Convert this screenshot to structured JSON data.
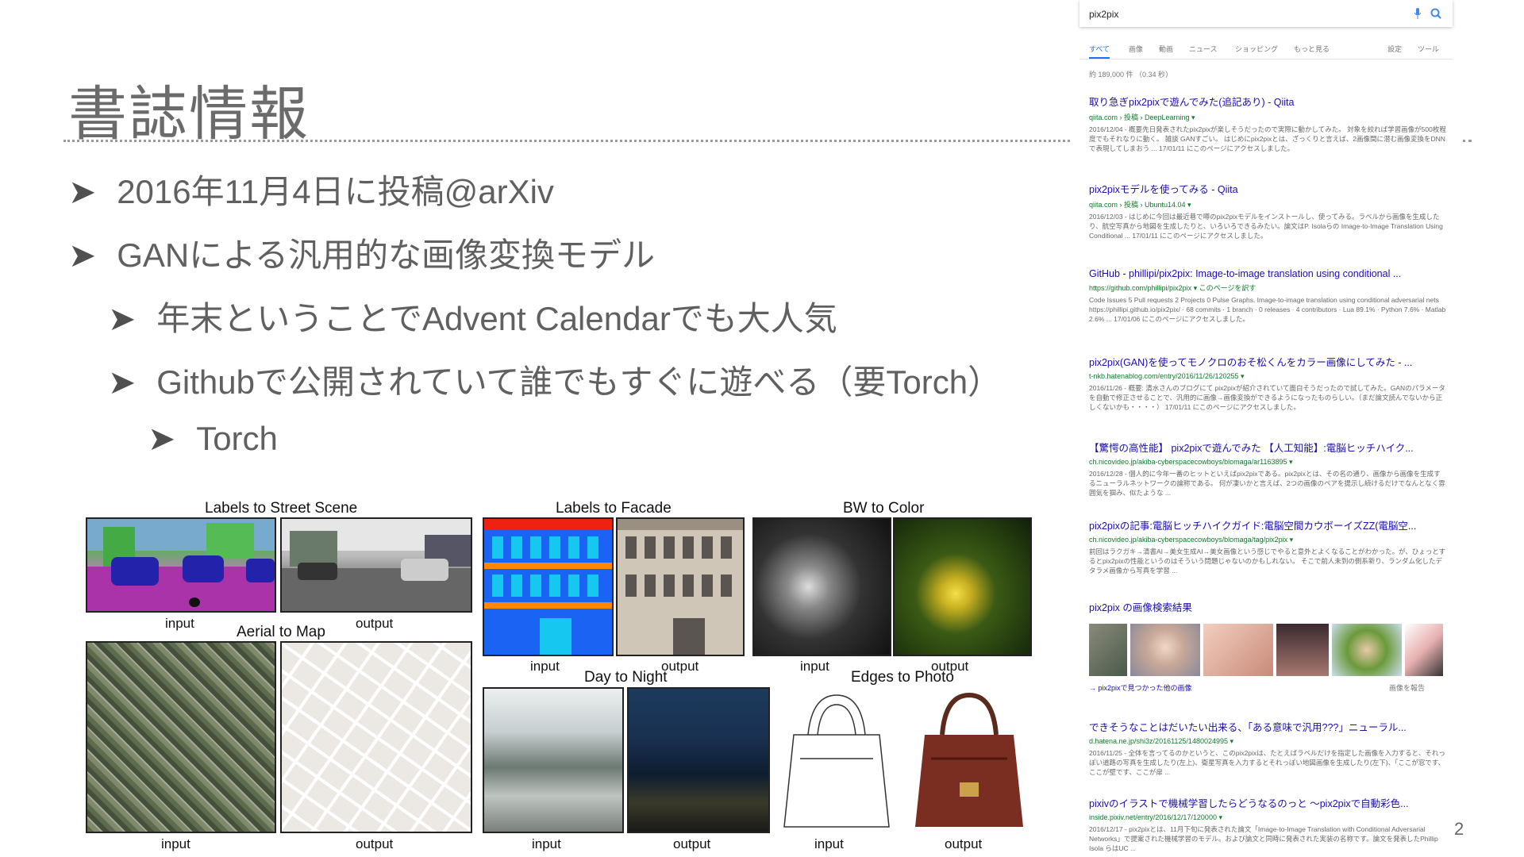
{
  "slide": {
    "title": "書誌情報",
    "page_number": "2",
    "bullets": [
      {
        "text": "2016年11月4日に投稿@arXiv",
        "level": 1
      },
      {
        "text": "GANによる汎用的な画像変換モデル",
        "level": 1
      },
      {
        "text": "年末ということでAdvent Calendarでも大人気",
        "level": 2
      },
      {
        "text": "Githubで公開されていて誰でもすぐに遊べる（要Torch）",
        "level": 2
      },
      {
        "text": "Torch",
        "level": 3
      }
    ],
    "bullet_marker": "➤"
  },
  "figure": {
    "captions": {
      "labels_street": "Labels to Street Scene",
      "labels_facade": "Labels to Facade",
      "bw_color": "BW to Color",
      "aerial_map": "Aerial to Map",
      "day_night": "Day to Night",
      "edges_photo": "Edges to Photo"
    },
    "input_label": "input",
    "output_label": "output"
  },
  "serp": {
    "query": "pix2pix",
    "tabs": [
      "すべて",
      "画像",
      "動画",
      "ニュース",
      "ショッピング",
      "もっと見る",
      "設定",
      "ツール"
    ],
    "result_count": "約 189,000 件 （0.34 秒）",
    "results": [
      {
        "title": "取り急ぎpix2pixで遊んでみた(追記あり) - Qiita",
        "url": "qiita.com › 投稿 › DeepLearning ▾",
        "snippet": "2016/12/04 - 概要先日発表されたpix2pixが楽しそうだったので実際に動かしてみた。 対象を絞れば学習画像が500枚程度でもそれなりに動く。 雑談 GANすごい。 はじめにpix2pixとは、ざっくりと言えば、2画像間に潜む画像変換をDNNで表現してしまおう ...\n17/01/11 にこのページにアクセスしました。"
      },
      {
        "title": "pix2pixモデルを使ってみる - Qiita",
        "url": "qiita.com › 投稿 › Ubuntu14.04 ▾",
        "snippet": "2016/12/03 - はじめに今回は最近巷で噂のpix2pixモデルをインストールし、使ってみる。ラベルから画像を生成したり、航空写真から地図を生成したりと、いろいろできるみたい。論文はP. Isolaらの Image-to-Image Translation Using Conditional ...\n17/01/11 にこのページにアクセスしました。"
      },
      {
        "title": "GitHub - phillipi/pix2pix: Image-to-image translation using conditional ...",
        "url": "https://github.com/phillipi/pix2pix ▾ このページを訳す",
        "snippet": "Code Issues 5 Pull requests 2 Projects 0 Pulse Graphs. Image-to-image translation using conditional adversarial nets https://phillipi.github.io/pix2pix/ · 68 commits · 1 branch · 0 releases · 4 contributors · Lua 89.1% · Python 7.6% · Matlab 2.6% ...\n17/01/06 にこのページにアクセスしました。"
      },
      {
        "title": "pix2pix(GAN)を使ってモノクロのおそ松くんをカラー画像にしてみた - ...",
        "url": "t-nkb.hatenablog.com/entry/2016/11/26/120255 ▾",
        "snippet": "2016/11/26 - 概要: 清水さんのブログにて pix2pixが紹介されていて面白そうだったので試してみた。GANのパラメータを自動で修正させることで、汎用的に画像→画像変換ができるようになったものらしい。（まだ論文読んでないから正しくないかも・・・・）\n17/01/11 にこのページにアクセスしました。"
      },
      {
        "title": "【驚愕の高性能】 pix2pixで遊んでみた 【人工知能】:電脳ヒッチハイク...",
        "url": "ch.nicovideo.jp/akiba-cyberspacecowboys/blomaga/ar1163895 ▾",
        "snippet": "2016/12/28 - 個人的に今年一番のヒットといえばpix2pixである。pix2pixとは、その名の通り、画像から画像を生成するニューラルネットワークの論称である。 何が凄いかと言えば、2つの画像のペアを提示し続けるだけでなんとなく雰囲気を掴み、似たような ..."
      },
      {
        "title": "pix2pixの記事:電脳ヒッチハイクガイド:電脳空間カウボーイズZZ(電脳空...",
        "url": "ch.nicovideo.jp/akiba-cyberspacecowboys/blomaga/tag/pix2pix ▾",
        "snippet": "前回はラクガキ→清書AI→美女生成AI→美女画像という感じでやると意外とよくなることがわかった。が、ひょっとするとpix2pixの性能というのはそういう問題じゃないのかもしれない。 そこで前人未到の側系新り、ランダム化したデタラメ画像から写真を学習 ..."
      }
    ],
    "image_section_title": "pix2pix の画像検索結果",
    "more_images": "pix2pixで見つかった他の画像",
    "report_images": "画像を報告",
    "results2": [
      {
        "title": "できそうなことはだいたい出来る、「ある意味で汎用???」ニューラル...",
        "url": "d.hatena.ne.jp/shi3z/20161125/1480024995 ▾",
        "snippet": "2016/11/25 - 全体を言ってるのかというと、このpix2pixは、たとえばラベルだけを指定した画像を入力すると、それっぽい道路の写真を生成したり(左上)、衛星写真を入力するとそれっぽい地図画像を生成したり(左下)、「ここが窓です、ここが壁です、ここが扉 ..."
      },
      {
        "title": "pixivのイラストで機械学習したらどうなるのっと ～pix2pixで自動彩色...",
        "url": "inside.pixiv.net/entry/2016/12/17/120000 ▾",
        "snippet": "2016/12/17 - pix2pixとは、11月下旬に発表された論文「Image-to-Image Translation with Conditional Adversarial Networks」で提案された機械学習のモデル。および論文と同時に発表された実装の名称です。論文を発表したPhillip Isola らはUC ..."
      }
    ]
  }
}
